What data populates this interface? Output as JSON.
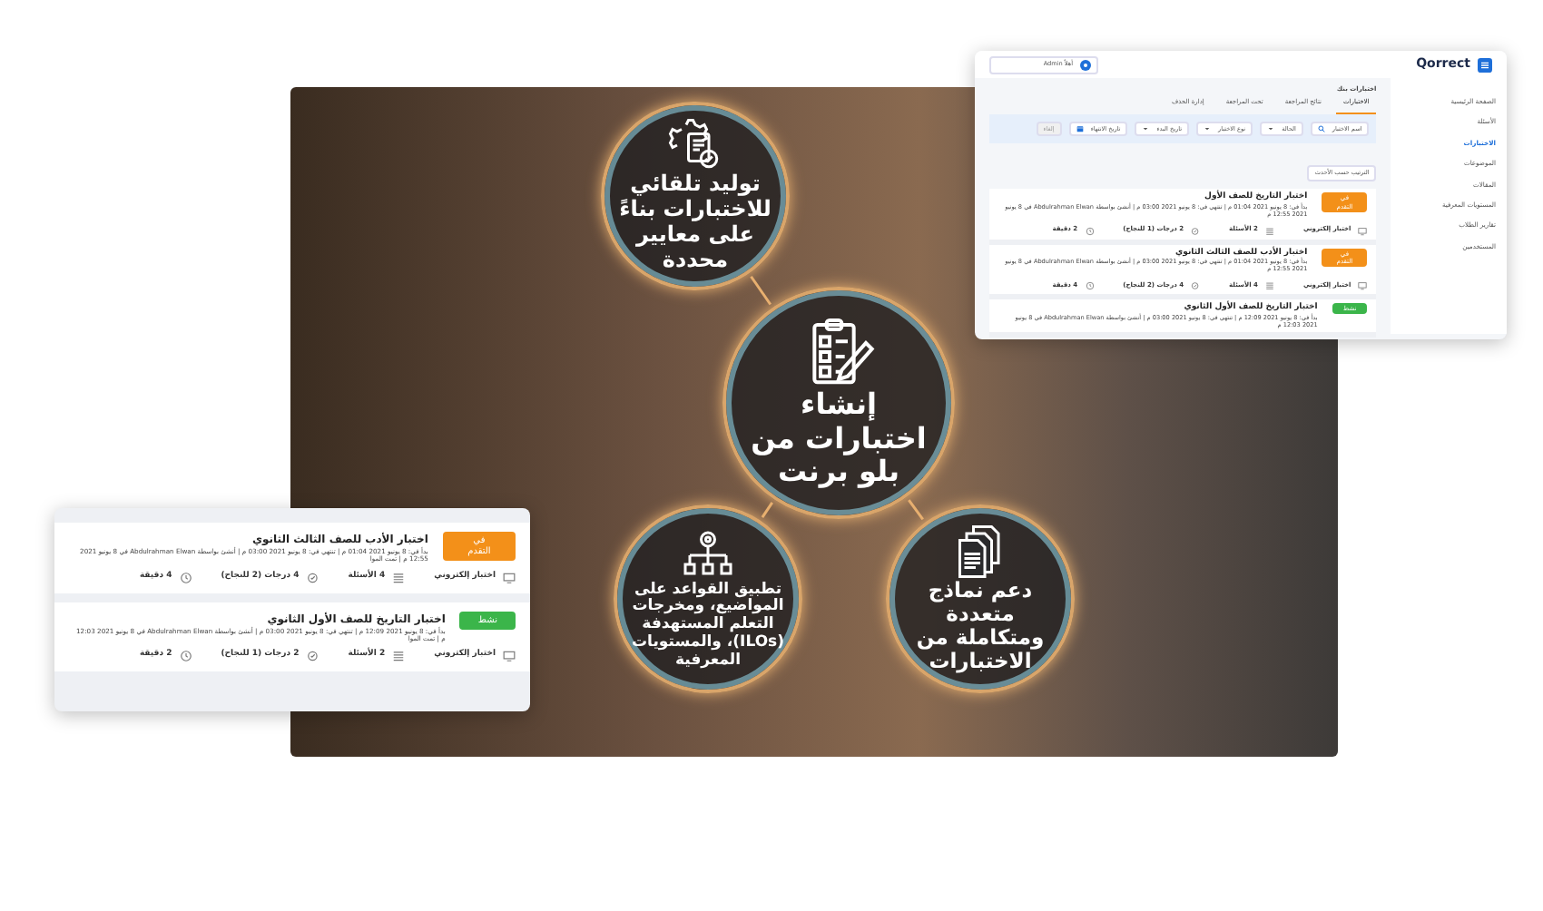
{
  "feature_circles": [
    {
      "kind": "generate",
      "text": "توليد تلقائي للاختبارات بناءً على معايير محددة"
    },
    {
      "kind": "create",
      "text": "إنشاء اختبارات من بلو برنت"
    },
    {
      "kind": "templates",
      "text": "دعم نماذج متعددة ومتكاملة من الاختبارات"
    },
    {
      "kind": "rules",
      "text": "تطبيق القواعد على المواضيع، ومخرجات التعلم المستهدفة (ILOs)، والمستويات المعرفية"
    }
  ],
  "exam_card": {
    "exams": [
      {
        "status": "في التقدم",
        "color": "#f39019",
        "title": "اختبار الأدب للصف الثالث الثانوي",
        "meta": "بدأ في: 8 يونيو 2021 01:04 م | تنتهي في: 8 يونيو 2021 03:00 م | أنشئ بواسطة Abdulrahman Elwan في 8 يونيو 2021 12:55 م | تمت الموا",
        "type": "اختبار إلكتروني",
        "questions": "4 الأسئلة",
        "marks": "4 درجات (2 للنجاح)",
        "duration": "4 دقيقة"
      },
      {
        "status": "نشط",
        "color": "#3bb54a",
        "title": "اختبار التاريخ للصف الأول الثانوي",
        "meta": "بدأ في: 8 يونيو 2021 12:09 م | تنتهي في: 8 يونيو 2021 03:00 م | أنشئ بواسطة Abdulrahman Elwan في 8 يونيو 2021 12:03 م | تمت الموا",
        "type": "اختبار إلكتروني",
        "questions": "2 الأسئلة",
        "marks": "2 درجات (1 للنجاح)",
        "duration": "2 دقيقة"
      }
    ]
  },
  "app_window": {
    "logo": "Qorrect",
    "user": "أهلاً Admin",
    "sidebar": [
      {
        "label": "الصفحة الرئيسية",
        "selected": false
      },
      {
        "label": "الأسئلة",
        "selected": false
      },
      {
        "label": "الاختبارات",
        "selected": true
      },
      {
        "label": "الموضوعات",
        "selected": false
      },
      {
        "label": "المقالات",
        "selected": false
      },
      {
        "label": "المستويات المعرفية",
        "selected": false
      },
      {
        "label": "تقارير الطلاب",
        "selected": false
      },
      {
        "label": "المستخدمين",
        "selected": false
      }
    ],
    "page_title": "اختبارات بنك",
    "tabs": [
      {
        "label": "الاختبارات",
        "selected": true
      },
      {
        "label": "نتائج المراجعة",
        "selected": false
      },
      {
        "label": "تحت المراجعة",
        "selected": false
      },
      {
        "label": "إدارة الحذف",
        "selected": false
      }
    ],
    "filters": [
      {
        "label": "اسم الاختبار",
        "kind": "search"
      },
      {
        "label": "الحالة",
        "kind": "select"
      },
      {
        "label": "نوع الاختبار",
        "kind": "select"
      },
      {
        "label": "تاريخ البدء",
        "kind": "select"
      },
      {
        "label": "تاريخ الانتهاء",
        "kind": "date"
      },
      {
        "label": "إلغاء",
        "kind": "button"
      }
    ],
    "sort": "الترتيب حسب الأحدث",
    "exams": [
      {
        "status": "في التقدم",
        "color": "#f39019",
        "title": "اختبار التاريخ للصف الأول",
        "meta": "بدأ في: 8 يونيو 2021 01:04 م | تنتهي في: 8 يونيو 2021 03:00 م | أنشئ بواسطة Abdulrahman Elwan في 8 يونيو 2021 12:55 م",
        "type": "اختبار إلكتروني",
        "questions": "2 الأسئلة",
        "marks": "2 درجات (1 للنجاح)",
        "duration": "2 دقيقة"
      },
      {
        "status": "في التقدم",
        "color": "#f39019",
        "title": "اختبار الأدب للصف الثالث الثانوي",
        "meta": "بدأ في: 8 يونيو 2021 01:04 م | تنتهي في: 8 يونيو 2021 03:00 م | أنشئ بواسطة Abdulrahman Elwan في 8 يونيو 2021 12:55 م",
        "type": "اختبار إلكتروني",
        "questions": "4 الأسئلة",
        "marks": "4 درجات (2 للنجاح)",
        "duration": "4 دقيقة"
      },
      {
        "status": "نشط",
        "color": "#3bb54a",
        "title": "اختبار التاريخ للصف الأول الثانوي",
        "meta": "بدأ في: 8 يونيو 2021 12:09 م | تنتهي في: 8 يونيو 2021 03:00 م | أنشئ بواسطة Abdulrahman Elwan في 8 يونيو 2021 12:03 م"
      }
    ]
  }
}
